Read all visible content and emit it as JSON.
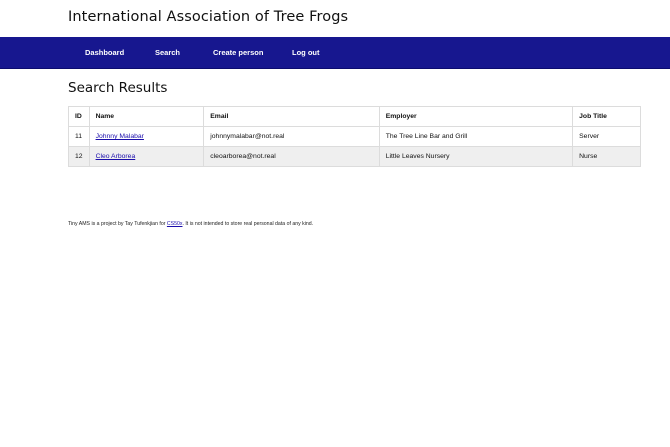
{
  "site": {
    "title": "International Association of Tree Frogs"
  },
  "nav": {
    "items": [
      {
        "label": "Dashboard"
      },
      {
        "label": "Search"
      },
      {
        "label": "Create person"
      },
      {
        "label": "Log out"
      }
    ]
  },
  "colors": {
    "navbar_bg": "#17178f",
    "link": "#1a0dab",
    "row_stripe": "#efefef"
  },
  "main": {
    "heading": "Search Results",
    "table": {
      "columns": [
        "ID",
        "Name",
        "Email",
        "Employer",
        "Job Title"
      ],
      "rows": [
        {
          "id": "11",
          "name": "Johnny Malabar",
          "email": "johnnymalabar@not.real",
          "employer": "The Tree Line Bar and Grill",
          "job_title": "Server"
        },
        {
          "id": "12",
          "name": "Cleo Arborea",
          "email": "cleoarborea@not.real",
          "employer": "Little Leaves Nursery",
          "job_title": "Nurse"
        }
      ]
    }
  },
  "footer": {
    "text_before": "Tiny AMS is a project by Tay Tufenkjian for ",
    "link_text": "CS50x",
    "text_after": ". It is not intended to store real personal data of any kind."
  }
}
